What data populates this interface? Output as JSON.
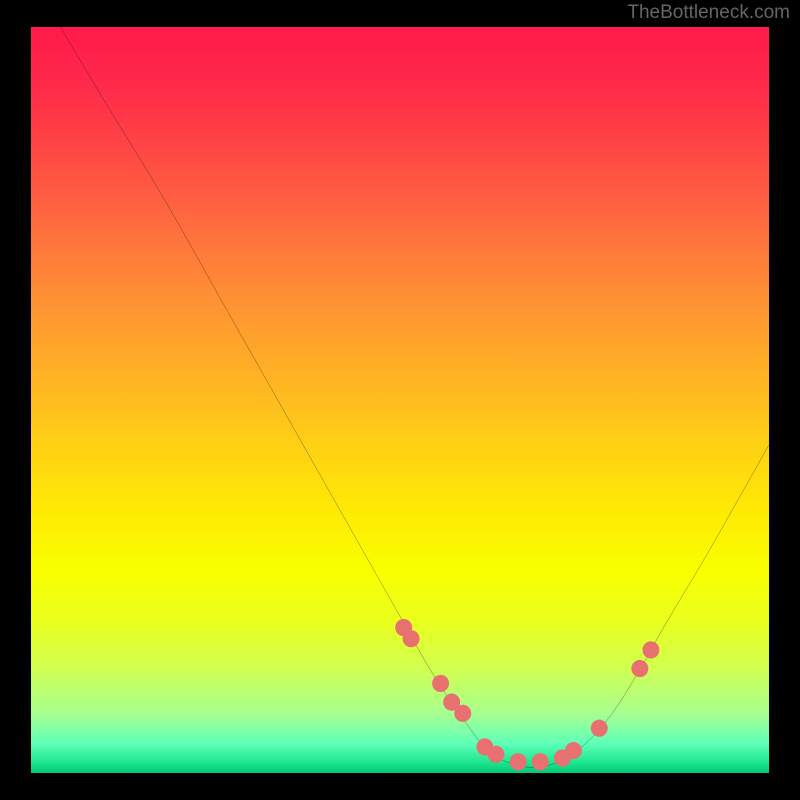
{
  "watermark": "TheBottleneck.com",
  "chart_data": {
    "type": "line",
    "title": "",
    "xlabel": "",
    "ylabel": "",
    "xlim": [
      0,
      100
    ],
    "ylim": [
      0,
      100
    ],
    "description": "Bottleneck curve (percentage bottleneck vs component balance), rainbow gradient background from red (high bottleneck) at top to green (no bottleneck) at bottom. A black V-shaped curve descends from top-left, reaches a minimum plateau around x≈62–72, and rises to mid-right. Salmon dots mark sample points near the valley.",
    "series": [
      {
        "name": "bottleneck_curve",
        "x": [
          4,
          10,
          18,
          26,
          34,
          42,
          50,
          54,
          58,
          62,
          66,
          70,
          74,
          78,
          82,
          86,
          92,
          100
        ],
        "values": [
          100,
          90,
          77,
          63,
          49,
          35,
          21,
          14,
          8,
          3,
          1,
          1,
          3,
          7,
          13,
          20,
          30,
          44
        ]
      },
      {
        "name": "sample_points",
        "x": [
          50.5,
          51.5,
          55.5,
          57.0,
          58.5,
          61.5,
          63.0,
          66.0,
          69.0,
          72.0,
          73.5,
          77.0,
          82.5,
          84.0
        ],
        "values": [
          19.5,
          18.0,
          12.0,
          9.5,
          8.0,
          3.5,
          2.5,
          1.5,
          1.5,
          2.0,
          3.0,
          6.0,
          14.0,
          16.5
        ]
      }
    ]
  }
}
